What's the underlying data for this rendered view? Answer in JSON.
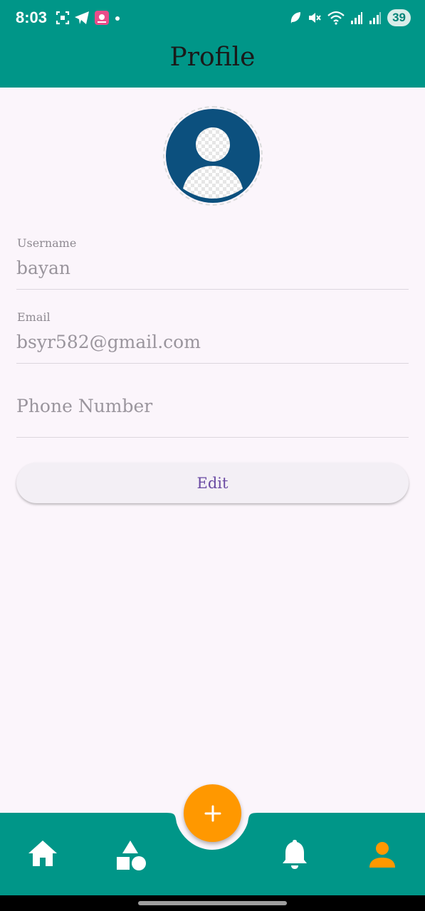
{
  "status_bar": {
    "time": "8:03",
    "battery": "39",
    "icons_left": [
      "screenshot-icon",
      "telegram-icon",
      "app-notification-icon",
      "dot-icon"
    ],
    "icons_right": [
      "leaf-icon",
      "mute-icon",
      "wifi-icon",
      "signal-icon",
      "signal-icon",
      "battery-icon"
    ]
  },
  "app_bar": {
    "title": "Profile",
    "color": "#009688"
  },
  "avatar": {
    "icon": "default-avatar-icon",
    "color": "#0c507e"
  },
  "form": {
    "username": {
      "label": "Username",
      "value": "bayan"
    },
    "email": {
      "label": "Email",
      "value": "bsyr582@gmail.com"
    },
    "phone": {
      "placeholder": "Phone Number",
      "value": ""
    }
  },
  "edit_button": {
    "label": "Edit"
  },
  "bottom_nav": {
    "items": [
      {
        "name": "home",
        "icon": "home-icon",
        "active": false
      },
      {
        "name": "categories",
        "icon": "shapes-icon",
        "active": false
      },
      {
        "name": "notifications",
        "icon": "bell-icon",
        "active": false
      },
      {
        "name": "profile",
        "icon": "person-icon",
        "active": true
      }
    ],
    "fab_icon": "plus-icon",
    "fab_color": "#ff9800",
    "active_color": "#ff9800"
  }
}
